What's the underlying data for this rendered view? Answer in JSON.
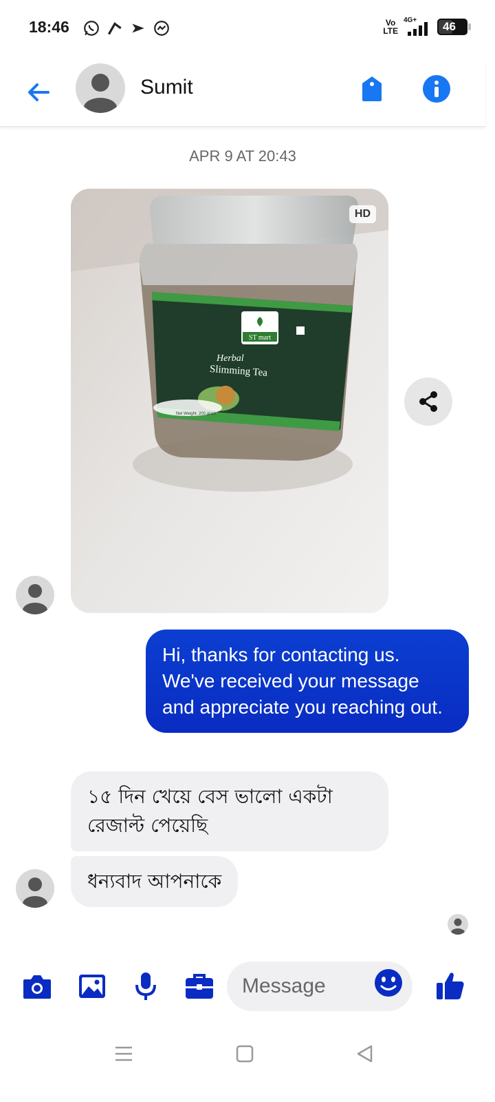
{
  "status_bar": {
    "time": "18:46",
    "network_label_top": "Vo",
    "network_label_bottom": "LTE",
    "signal_label": "4G+",
    "battery": "46"
  },
  "header": {
    "contact_name": "Sumit"
  },
  "conversation": {
    "timestamp": "APR 9 AT 20:43",
    "photo_badge": "HD",
    "outgoing_message": "Hi, thanks for contacting us. We've received your message and appreciate you reaching out.",
    "incoming_messages": [
      "১৫ দিন খেয়ে বেস ভালো একটা রেজাল্ট পেয়েছি",
      "ধন্যবাদ আপনাকে"
    ]
  },
  "photo": {
    "brand": "ST mart",
    "line1": "Herbal",
    "line2": "Slimming Tea",
    "weight": "Net Weight: 200 gram"
  },
  "composer": {
    "placeholder": "Message"
  },
  "colors": {
    "accent": "#1877f2",
    "composer_icon": "#0a2cc2",
    "bubble_outgoing": "#0b3fd1",
    "bubble_incoming": "#f0f0f3"
  },
  "icons": {
    "back": "arrow-left-icon",
    "tag": "tag-icon",
    "info": "info-icon",
    "share": "share-icon",
    "camera": "camera-icon",
    "gallery": "image-icon",
    "mic": "microphone-icon",
    "briefcase": "briefcase-icon",
    "emoji": "smiley-icon",
    "like": "thumbs-up-icon"
  }
}
